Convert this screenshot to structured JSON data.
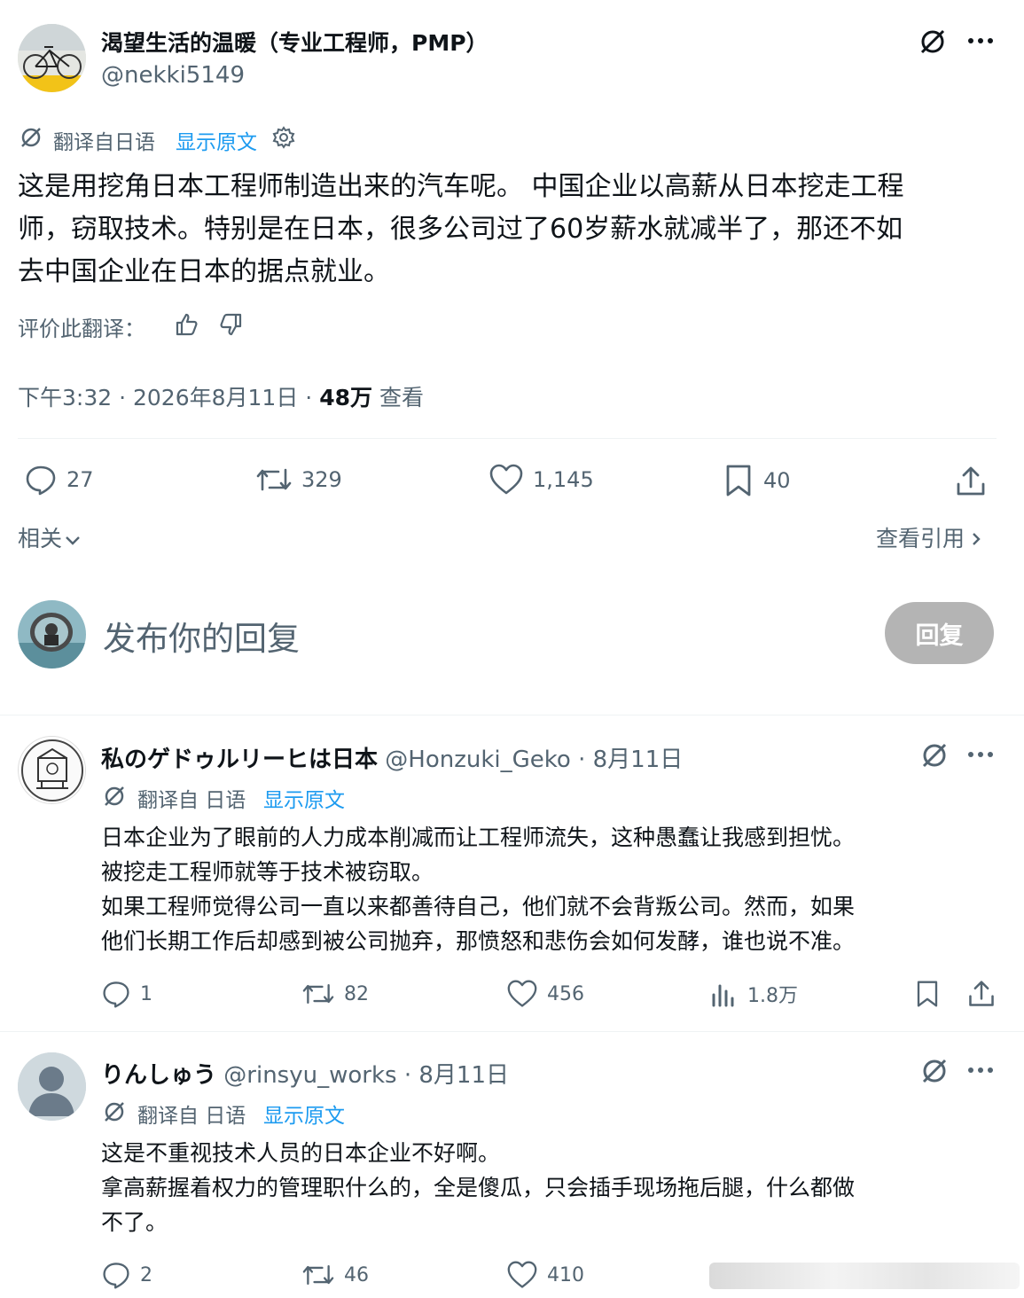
{
  "main_post": {
    "display_name": "渴望生活的温暖（专业工程师，PMP）",
    "handle": "@nekki5149",
    "translated_from": "翻译自日语",
    "show_original": "显示原文",
    "body_lines": [
      "这是用挖角日本工程师制造出来的汽车呢。 中国企业以高薪从日本挖走工程",
      "师，窃取技术。特别是在日本，很多公司过了60岁薪水就减半了，那还不如",
      "去中国企业在日本的据点就业。"
    ],
    "rate_translation": "评价此翻译：",
    "time": "下午3:32",
    "date": "2026年8月11日",
    "views_count": "48万",
    "views_label": "查看",
    "replies": "27",
    "reposts": "329",
    "likes": "1,145",
    "bookmarks": "40",
    "related": "相关",
    "view_quotes": "查看引用"
  },
  "composer": {
    "placeholder": "发布你的回复",
    "reply_button": "回复"
  },
  "replies": [
    {
      "display_name": "私のゲドゥルリーヒは日本",
      "handle": "@Honzuki_Geko",
      "date": "8月11日",
      "translated_from": "翻译自 日语",
      "show_original": "显示原文",
      "body_lines": [
        "日本企业为了眼前的人力成本削减而让工程师流失，这种愚蠢让我感到担忧。",
        "被挖走工程师就等于技术被窃取。",
        "如果工程师觉得公司一直以来都善待自己，他们就不会背叛公司。然而，如果",
        "他们长期工作后却感到被公司抛弃，那愤怒和悲伤会如何发酵，谁也说不准。"
      ],
      "replies": "1",
      "reposts": "82",
      "likes": "456",
      "views": "1.8万"
    },
    {
      "display_name": "りんしゅう",
      "handle": "@rinsyu_works",
      "date": "8月11日",
      "translated_from": "翻译自 日语",
      "show_original": "显示原文",
      "body_lines": [
        "这是不重视技术人员的日本企业不好啊。",
        "拿高薪握着权力的管理职什么的，全是傻瓜，只会插手现场拖后腿，什么都做",
        "不了。"
      ],
      "replies": "2",
      "reposts": "46",
      "likes": "410"
    }
  ],
  "separator": "·",
  "colors": {
    "text": "#0f1419",
    "secondary": "#536471",
    "link": "#1d9bf0",
    "border": "#eff3f4",
    "reply_button_disabled": "#b4b4b4"
  },
  "icons": [
    "grok-icon",
    "more-icon",
    "translate-icon",
    "gear-icon",
    "thumbs-up-icon",
    "thumbs-down-icon",
    "reply-icon",
    "repost-icon",
    "like-icon",
    "bookmark-icon",
    "share-icon",
    "views-icon",
    "chevron-down-icon",
    "chevron-right-icon"
  ]
}
